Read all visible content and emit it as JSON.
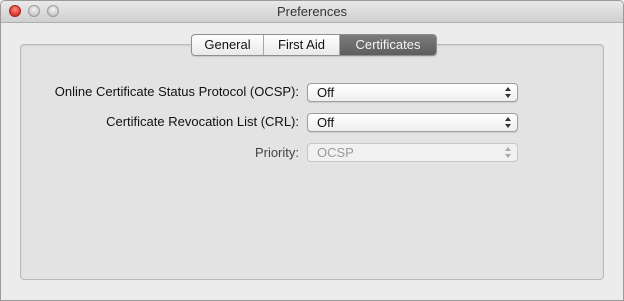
{
  "window": {
    "title": "Preferences"
  },
  "tabs": [
    {
      "label": "General"
    },
    {
      "label": "First Aid"
    },
    {
      "label": "Certificates"
    }
  ],
  "settings": {
    "ocsp": {
      "label": "Online Certificate Status Protocol (OCSP):",
      "value": "Off"
    },
    "crl": {
      "label": "Certificate Revocation List (CRL):",
      "value": "Off"
    },
    "priority": {
      "label": "Priority:",
      "value": "OCSP",
      "enabled": false
    }
  }
}
